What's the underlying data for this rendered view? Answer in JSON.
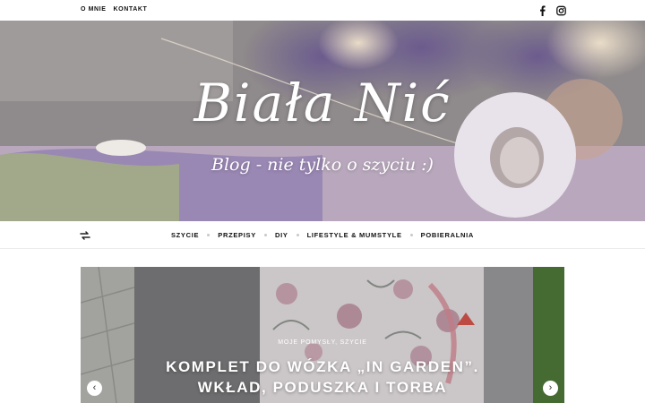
{
  "topbar": {
    "links": [
      "O MNIE",
      "KONTAKT"
    ],
    "social_icons": [
      "facebook-icon",
      "instagram-icon"
    ]
  },
  "header": {
    "title": "Biała Nić",
    "tagline": "Blog - nie tylko o szyciu :)"
  },
  "main_nav": {
    "shuffle_icon": "shuffle-icon",
    "items": [
      "SZYCIE",
      "PRZEPISY",
      "DIY",
      "LIFESTYLE & MUMSTYLE",
      "POBIERALNIA"
    ]
  },
  "slider": {
    "categories": "MOJE POMYSŁY, SZYCIE",
    "title_line1": "KOMPLET DO WÓZKA „IN GARDEN”.",
    "title_line2": "WKŁAD, PODUSZKA I TORBA",
    "prev_icon": "chevron-left-icon",
    "next_icon": "chevron-right-icon"
  }
}
